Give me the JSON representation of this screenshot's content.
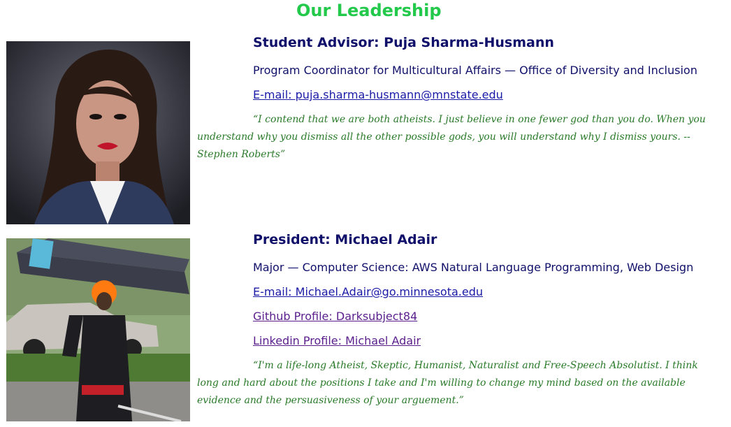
{
  "page": {
    "title": "Our Leadership"
  },
  "members": [
    {
      "role_title": "Student Advisor: Puja Sharma-Husmann",
      "lines": [
        {
          "text": "Program Coordinator for Multicultural Affairs — Office of Diversity and Inclusion",
          "kind": "text"
        },
        {
          "text": "E-mail: puja.sharma-husmann@mnstate.edu",
          "kind": "link"
        }
      ],
      "quote": "“I contend that we are both atheists. I just believe in one fewer god than you do. When you understand why you dismiss all the other possible gods, you will understand why I dismiss yours. -- Stephen Roberts”"
    },
    {
      "role_title": "President: Michael Adair",
      "lines": [
        {
          "text": "Major — Computer Science: AWS Natural Language Programming, Web Design",
          "kind": "text"
        },
        {
          "text": "E-mail: Michael.Adair@go.minnesota.edu",
          "kind": "link"
        },
        {
          "text": "Github Profile: Darksubject84",
          "kind": "visited-link"
        },
        {
          "text": "Linkedin Profile: Michael Adair",
          "kind": "visited-link"
        }
      ],
      "quote": "“I'm a life-long Atheist, Skeptic, Humanist, Naturalist and Free-Speech Absolutist. I think long and hard about the positions I take and I'm willing to change my mind based on the available evidence and the persuasiveness of your arguement.”"
    }
  ],
  "colors": {
    "heading_green": "#22c94a",
    "navy_text": "#10106a",
    "link_blue": "#1a1aa6",
    "visited_purple": "#5a1f8c",
    "quote_green": "#2a7a2a"
  }
}
